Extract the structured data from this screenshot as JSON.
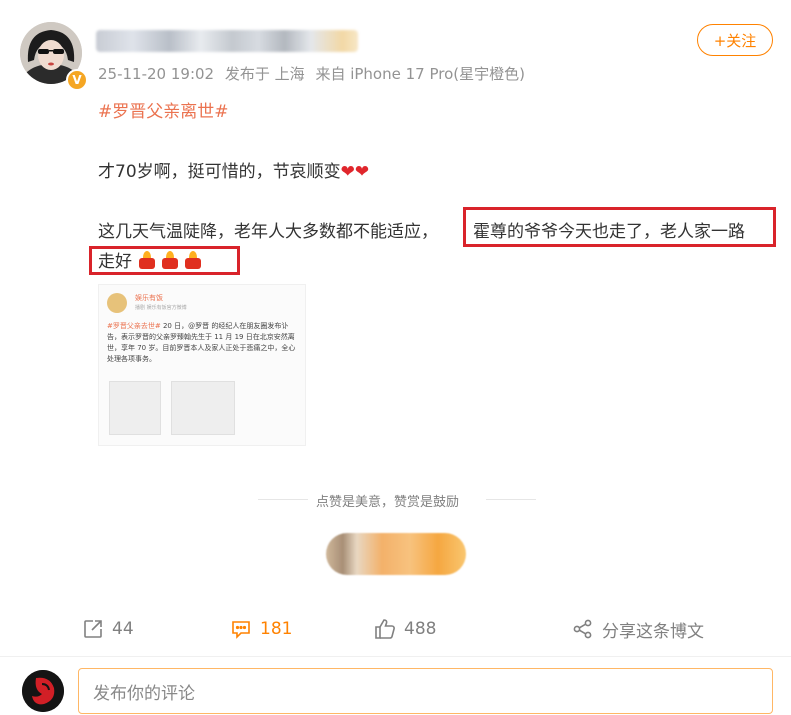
{
  "post": {
    "meta": {
      "time": "25-11-20 19:02",
      "location": "发布于 上海",
      "source": "来自 iPhone 17 Pro(星宇橙色)"
    },
    "follow_label": "+关注",
    "hashtag": "#罗晋父亲离世#",
    "line1": "才70岁啊，挺可惜的，节哀顺变",
    "hearts": "❤❤",
    "line2_a": "这几天气温陡降，老年人大多数都不能适应，",
    "line2_b": "霍尊的爷爷今天也走了，老人家一路",
    "line3": "走好"
  },
  "embedded": {
    "account_name": "娱乐有饭",
    "account_sub": "播剧 娱乐有饭官方微博",
    "hashtag": "#罗晋父亲去世#",
    "text": " 20 日，@罗晋 的经纪人在朋友圈发布讣告，表示罗晋的父亲罗臻翰先生于 11 月 19 日在北京安然离世，享年 70 岁。目前罗晋本人及家人正处于悲痛之中，全心处理各项事务。"
  },
  "reward": {
    "text": "点赞是美意，赞赏是鼓励"
  },
  "actions": {
    "forward_count": "44",
    "comment_count": "181",
    "like_count": "488",
    "share_label": "分享这条博文"
  },
  "comment": {
    "placeholder": "发布你的评论"
  },
  "colors": {
    "accent": "#ff8200",
    "hashtag": "#eb7350",
    "highlight_box": "#d9232a"
  }
}
